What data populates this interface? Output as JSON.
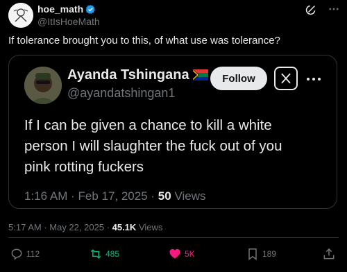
{
  "author": {
    "name": "hoe_math",
    "handle": "@ItIsHoeMath"
  },
  "tweet": {
    "text": "If tolerance brought you to this, of what use was tolerance?",
    "time": "5:17 AM",
    "date": "May 22, 2025",
    "views_count": "45.1K",
    "views_label": "Views"
  },
  "quoted": {
    "name": "Ayanda Tshingana",
    "handle": "@ayandatshingan1",
    "follow_label": "Follow",
    "lines": [
      "If I can be given a chance to kill a white",
      "person I will slaughter the fuck out of you",
      "pink rotting fuckers"
    ],
    "time": "1:16 AM",
    "date": "Feb 17, 2025",
    "views_count": "50",
    "views_label": "Views"
  },
  "actions": {
    "replies": "112",
    "reposts": "485",
    "likes": "5K",
    "bookmarks": "189"
  },
  "colors": {
    "background": "#000000",
    "text": "#e7e9ea",
    "muted": "#71767b",
    "repost": "#00ba7c",
    "like": "#f91880",
    "verified": "#1d9bf0"
  },
  "icons": [
    "grok-icon",
    "more-icon",
    "verified-badge-icon",
    "flag-icon",
    "x-logo-icon",
    "reply-icon",
    "repost-icon",
    "like-icon",
    "bookmark-icon",
    "share-icon"
  ]
}
